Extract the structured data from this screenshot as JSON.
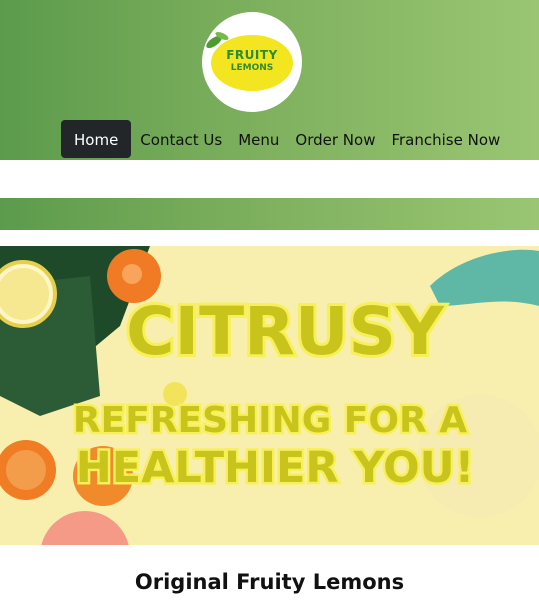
{
  "logo": {
    "line1": "FRUITY",
    "line2": "LEMONS"
  },
  "nav": {
    "items": [
      {
        "label": "Home",
        "active": true
      },
      {
        "label": "Contact Us"
      },
      {
        "label": "Menu"
      },
      {
        "label": "Order Now"
      },
      {
        "label": "Franchise Now"
      }
    ]
  },
  "hero": {
    "line1": "CITRUSY",
    "line2": "REFRESHING FOR A",
    "line3": "HEALTHIER YOU!"
  },
  "section": {
    "title": "Original Fruity Lemons"
  },
  "colors": {
    "brand_green": "#6aa555",
    "hero_text": "#c9c41c",
    "nav_active": "#222629"
  }
}
